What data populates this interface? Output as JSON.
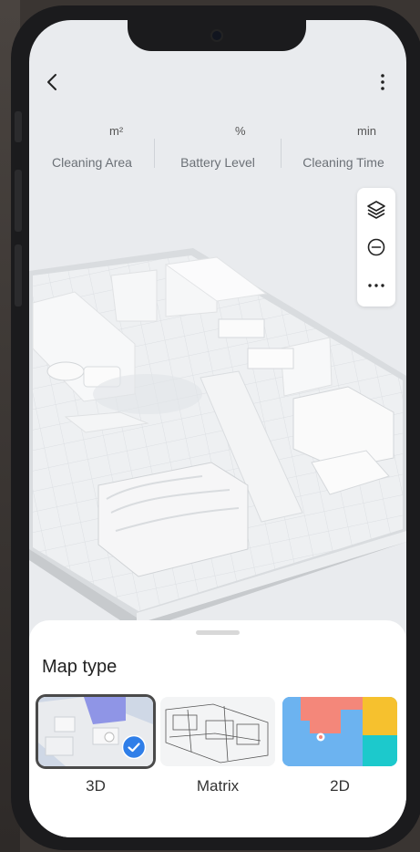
{
  "header": {
    "back_icon": "chevron-left-icon",
    "more_icon": "more-vertical-icon"
  },
  "stats": [
    {
      "unit": "m²",
      "label": "Cleaning Area"
    },
    {
      "unit": "%",
      "label": "Battery Level"
    },
    {
      "unit": "min",
      "label": "Cleaning Time"
    }
  ],
  "map_tools": [
    "layers-icon",
    "zoom-out-icon",
    "more-horizontal-icon"
  ],
  "map_type": {
    "title": "Map type",
    "options": [
      {
        "label": "3D",
        "selected": true
      },
      {
        "label": "Matrix",
        "selected": false
      },
      {
        "label": "2D",
        "selected": false
      }
    ]
  },
  "colors": {
    "accent": "#2f7ee8",
    "room_red": "#f4877a",
    "room_blue": "#6cb3f0",
    "room_yellow": "#f6c12e",
    "room_teal": "#1cc9cc"
  }
}
